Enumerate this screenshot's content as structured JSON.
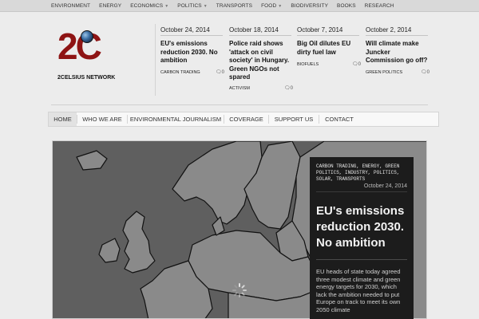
{
  "top_nav": [
    {
      "label": "Environment",
      "dropdown": false
    },
    {
      "label": "Energy",
      "dropdown": false
    },
    {
      "label": "Economics",
      "dropdown": true
    },
    {
      "label": "Politics",
      "dropdown": true
    },
    {
      "label": "Transports",
      "dropdown": false
    },
    {
      "label": "Food",
      "dropdown": true
    },
    {
      "label": "Biodiversity",
      "dropdown": false
    },
    {
      "label": "Books",
      "dropdown": false
    },
    {
      "label": "Research",
      "dropdown": false
    }
  ],
  "logo": {
    "mark": "2C",
    "name": "2CELSIUS NETWORK"
  },
  "header_articles": [
    {
      "date": "October 24, 2014",
      "title": "EU's emissions reduction 2030. No ambition",
      "category": "Carbon Trading",
      "comments": "0"
    },
    {
      "date": "October 18, 2014",
      "title": "Police raid shows 'attack on civil society' in Hungary. Green NGOs not spared",
      "category": "Activism",
      "comments": "0"
    },
    {
      "date": "October 7, 2014",
      "title": "Big Oil dilutes EU dirty fuel law",
      "category": "Biofuels",
      "comments": "0"
    },
    {
      "date": "October 2, 2014",
      "title": "Will climate make Juncker Commission go off?",
      "category": "Green Politics",
      "comments": "0"
    }
  ],
  "main_nav": [
    "Home",
    "Who we are",
    "Environmental Journalism",
    "Coverage",
    "Support us",
    "Contact"
  ],
  "main_nav_active": "Home",
  "featured": {
    "tags": "Carbon Trading, Energy, Green Politics, Industry, Politics, Solar, Transports",
    "date": "October 24, 2014",
    "title": "EU's emissions reduction 2030. No ambition",
    "excerpt": "EU heads of state today agreed three modest climate and green energy targets for 2030, which lack the ambition needed to put Europe on track to meet its own 2050 climate"
  },
  "icons": {
    "comment": "comment-icon",
    "caret": "caret-down-icon",
    "spinner": "loading-spinner-icon"
  },
  "colors": {
    "brand": "#8e1414",
    "map_sea": "#5f5f5f",
    "map_land": "#8a8a8a",
    "overlay": "#1c1c1c"
  }
}
